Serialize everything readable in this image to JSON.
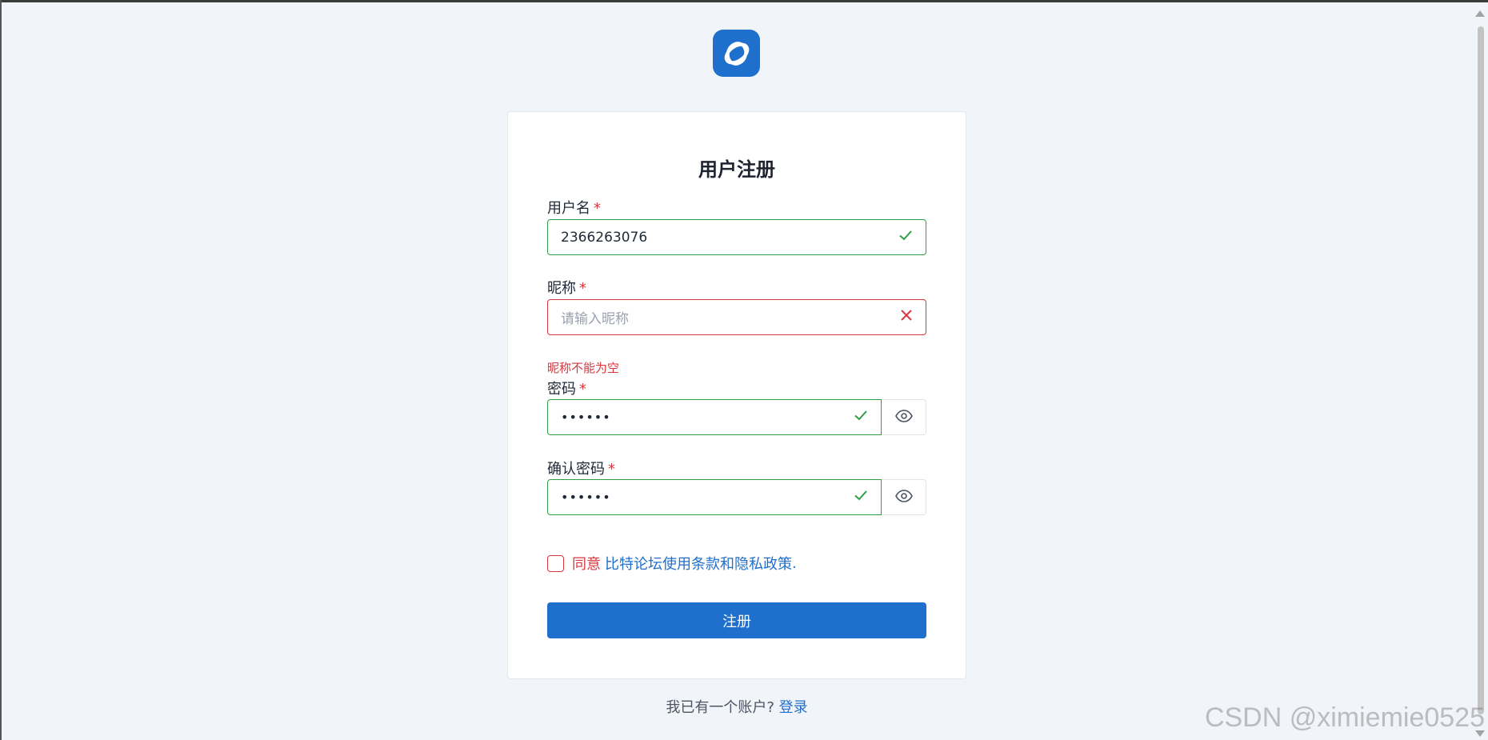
{
  "card": {
    "title": "用户注册"
  },
  "fields": {
    "username": {
      "label": "用户名",
      "required_mark": "*",
      "value": "2366263076"
    },
    "nickname": {
      "label": "昵称",
      "required_mark": "*",
      "placeholder": "请输入昵称",
      "error": "昵称不能为空"
    },
    "password": {
      "label": "密码",
      "required_mark": "*",
      "masked_value": "••••••"
    },
    "confirm_password": {
      "label": "确认密码",
      "required_mark": "*",
      "masked_value": "••••••"
    }
  },
  "agreement": {
    "prefix": "同意",
    "link_text": "比特论坛使用条款和隐私政策",
    "suffix": "."
  },
  "submit": {
    "label": "注册"
  },
  "footer": {
    "text": "我已有一个账户? ",
    "login_link": "登录"
  },
  "watermark": "CSDN @ximiemie0525",
  "colors": {
    "primary": "#1f6fcc",
    "valid": "#2e9e45",
    "error": "#d9363e",
    "background": "#f1f4f9"
  },
  "icons": {
    "logo": "app-logo",
    "valid": "check-icon",
    "invalid": "x-icon",
    "reveal": "eye-icon"
  }
}
